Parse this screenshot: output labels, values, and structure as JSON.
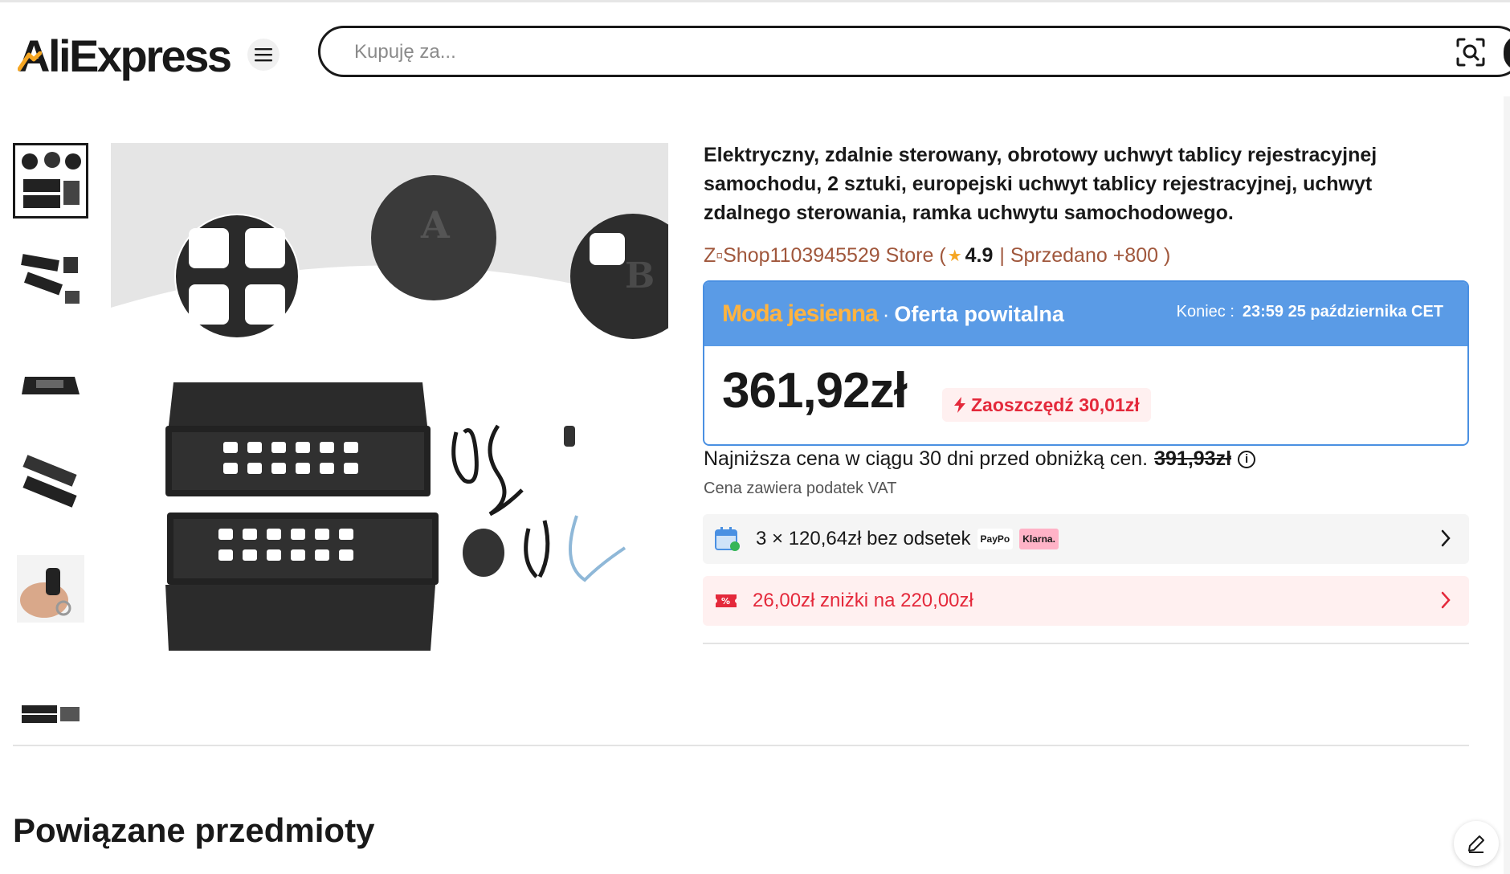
{
  "header": {
    "logo": "AliExpress",
    "search_placeholder": "Kupuję za...",
    "icons": [
      "menu-icon",
      "camera-search-icon"
    ]
  },
  "gallery": {
    "thumbnails": [
      "thumb-1",
      "thumb-2",
      "thumb-3",
      "thumb-4",
      "thumb-5",
      "thumb-6"
    ],
    "active_index": 0
  },
  "product": {
    "title": "Elektryczny, zdalnie sterowany, obrotowy uchwyt tablicy rejestracyjnej samochodu, 2 sztuki, europejski uchwyt tablicy rejestracyjnej, uchwyt zdalnego sterowania, ramka uchwytu samochodowego.",
    "store_name": "Z▫Shop1103945529 Store (",
    "rating": "4.9",
    "sold": "| Sprzedano +800 )"
  },
  "promo": {
    "fashion_label": "Moda jesienna",
    "offer_label": "Oferta powitalna",
    "end_label": "Koniec :",
    "end_value": "23:59 25 października CET",
    "price": "361,92zł",
    "save_label": "Zaoszczędź 30,01zł"
  },
  "lowest_price": {
    "text": "Najniższa cena w ciągu 30 dni przed obniżką cen.",
    "old_price": "391,93zł"
  },
  "vat_note": "Cena zawiera podatek VAT",
  "installments": {
    "text": "3 × 120,64zł bez odsetek",
    "badge_paypo": "PayPo",
    "badge_klarna": "Klarna."
  },
  "coupon": {
    "text": "26,00zł zniżki na 220,00zł"
  },
  "related_title": "Powiązane przedmioty",
  "colors": {
    "brand_orange": "#f5a623",
    "promo_blue": "#5a9be6",
    "discount_red": "#e4293b",
    "store_brown": "#a0573c"
  }
}
